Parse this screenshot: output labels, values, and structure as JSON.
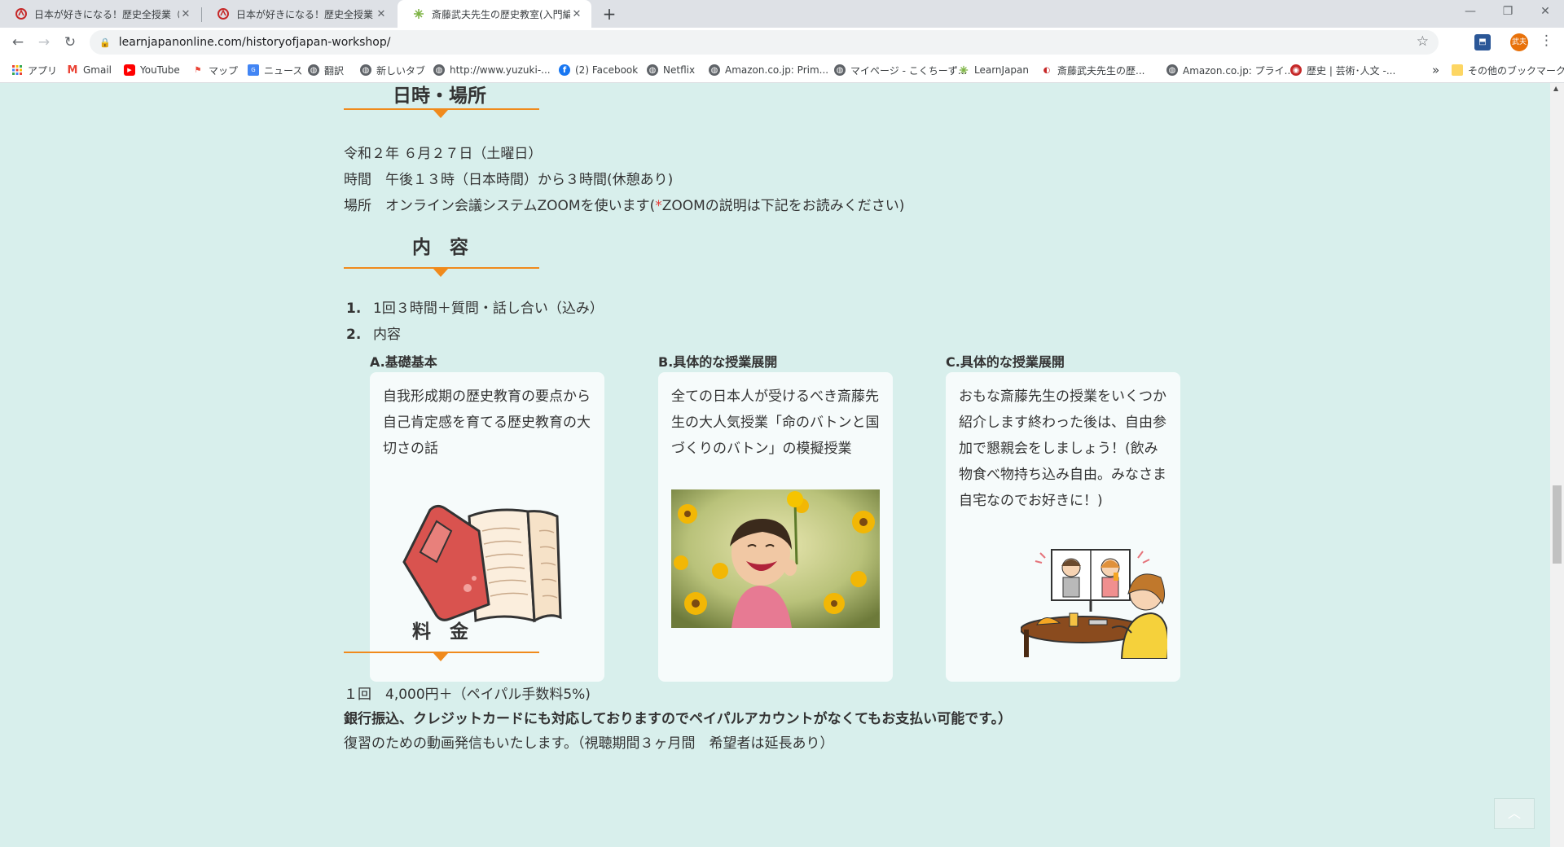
{
  "browser": {
    "tabs": [
      {
        "title": "日本が好きになる！歴史全授業（",
        "close": "✕"
      },
      {
        "title": "日本が好きになる！歴史全授業（",
        "close": "✕"
      },
      {
        "title": "斎藤武夫先生の歴史教室(入門編",
        "close": "✕"
      }
    ],
    "new_tab": "+",
    "window_controls": {
      "minimize": "—",
      "restore": "❐",
      "close": "✕"
    },
    "url": "learnjapanonline.com/historyofjapan-workshop/",
    "profile_label": "武夫",
    "bookmarks": [
      {
        "label": "アプリ",
        "icon": "apps-grid-icon"
      },
      {
        "label": "Gmail",
        "icon": "gmail-icon"
      },
      {
        "label": "YouTube",
        "icon": "youtube-icon"
      },
      {
        "label": "マップ",
        "icon": "maps-icon"
      },
      {
        "label": "ニュース",
        "icon": "news-icon"
      },
      {
        "label": "翻訳",
        "icon": "globe-icon"
      },
      {
        "label": "新しいタブ",
        "icon": "globe-icon"
      },
      {
        "label": "http://www.yuzuki-...",
        "icon": "globe-icon"
      },
      {
        "label": "(2) Facebook",
        "icon": "facebook-icon"
      },
      {
        "label": "Netflix",
        "icon": "globe-icon"
      },
      {
        "label": "Amazon.co.jp: Prim...",
        "icon": "globe-icon"
      },
      {
        "label": "マイページ - こくちーず...",
        "icon": "globe-icon"
      },
      {
        "label": "LearnJapan",
        "icon": "learnjapan-icon"
      },
      {
        "label": "斎藤武夫先生の歴...",
        "icon": "site-icon"
      },
      {
        "label": "Amazon.co.jp: プライ...",
        "icon": "globe-icon"
      },
      {
        "label": "歴史 | 芸術･人文 -...",
        "icon": "site-red-icon"
      }
    ],
    "more_bookmarks": "»",
    "other_bookmarks": "その他のブックマーク"
  },
  "schedule": {
    "heading": "日時・場所",
    "date": "令和２年 ６月２７日（土曜日）",
    "time": "時間　午後１３時（日本時間）から３時間(休憩あり)",
    "place_prefix": "場所　オンライン会議システムZOOMを使います(",
    "place_mark": "*",
    "place_suffix": "ZOOMの説明は下記をお読みください)"
  },
  "content": {
    "heading": "内　容",
    "items": [
      {
        "num": "1.",
        "text": "1回３時間＋質問・話し合い（込み）"
      },
      {
        "num": "2.",
        "text": "内容"
      }
    ],
    "cards": [
      {
        "label": "A.基礎基本",
        "text": "自我形成期の歴史教育の要点から自己肯定感を育てる歴史教育の大切さの話",
        "image": "open-book-illustration"
      },
      {
        "label": "B.具体的な授業展開",
        "text": "全ての日本人が受けるべき斎藤先生の大人気授業「命のバトンと国づくりのバトン」の模擬授業",
        "image": "laughing-child-sunflowers-photo"
      },
      {
        "label": "C.具体的な授業展開",
        "text": "おもな斎藤先生の授業をいくつか紹介します終わった後は、自由参加で懇親会をしましょう！(飲み物食べ物持ち込み自由。みなさま自宅なのでお好きに！)",
        "image": "online-meeting-illustration"
      }
    ]
  },
  "fee": {
    "heading": "料　金",
    "price": "１回　4,000円＋（ペイパル手数料5%)",
    "payment": "銀行振込、クレジットカードにも対応しておりますのでペイパルアカウントがなくてもお支払い可能です。）",
    "video": "復習のための動画発信もいたします。（視聴期間３ヶ月間　希望者は延長あり）"
  },
  "back_to_top": "︿"
}
